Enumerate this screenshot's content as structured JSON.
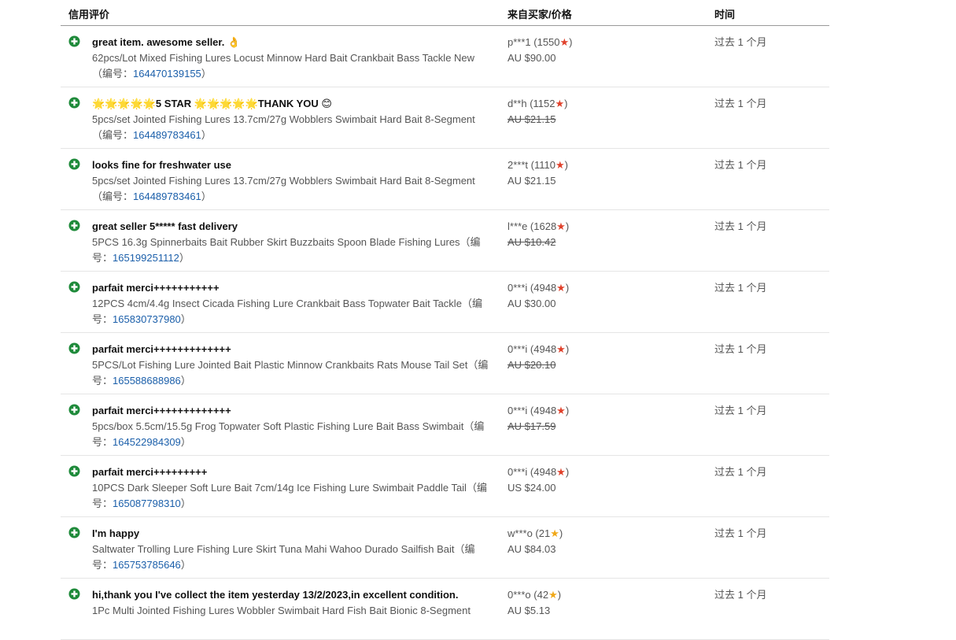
{
  "header": {
    "col_feedback": "信用评价",
    "col_from": "来自买家/价格",
    "col_time": "时间"
  },
  "colors": {
    "positive_green": "#1e8a3a",
    "link_blue": "#1b5faa",
    "star_red": "#e0412b",
    "star_yellow": "#f0a818"
  },
  "item_prefix": "（编号：",
  "item_suffix": "）",
  "rows": [
    {
      "comment": "great item. awesome seller. 👌",
      "desc": "62pcs/Lot Mixed Fishing Lures Locust Minnow Hard Bait Crankbait Bass Tackle New",
      "item": "164470139155",
      "buyer": "p***1",
      "score": "1550",
      "star": "red",
      "price": "AU $90.00",
      "strike": false,
      "time": "过去 1 个月"
    },
    {
      "comment": "🌟🌟🌟🌟🌟5 STAR 🌟🌟🌟🌟🌟THANK YOU 😊",
      "desc": "5pcs/set Jointed Fishing Lures 13.7cm/27g Wobblers Swimbait Hard Bait 8-Segment",
      "item": "164489783461",
      "buyer": "d**h",
      "score": "1152",
      "star": "red",
      "price": "AU $21.15",
      "strike": true,
      "time": "过去 1 个月"
    },
    {
      "comment": "looks fine for freshwater use",
      "desc": "5pcs/set Jointed Fishing Lures 13.7cm/27g Wobblers Swimbait Hard Bait 8-Segment",
      "item": "164489783461",
      "buyer": "2***t",
      "score": "1110",
      "star": "red",
      "price": "AU $21.15",
      "strike": false,
      "time": "过去 1 个月"
    },
    {
      "comment": "great seller 5***** fast delivery",
      "desc": "5PCS 16.3g Spinnerbaits Bait Rubber Skirt Buzzbaits Spoon Blade Fishing Lures",
      "item": "165199251112",
      "buyer": "l***e",
      "score": "1628",
      "star": "red",
      "price": "AU $10.42",
      "strike": true,
      "time": "过去 1 个月"
    },
    {
      "comment": "parfait merci+++++++++++",
      "desc": "12PCS 4cm/4.4g Insect Cicada Fishing Lure Crankbait Bass Topwater Bait Tackle",
      "item": "165830737980",
      "buyer": "0***i",
      "score": "4948",
      "star": "red",
      "price": "AU $30.00",
      "strike": false,
      "time": "过去 1 个月"
    },
    {
      "comment": "parfait merci+++++++++++++",
      "desc": "5PCS/Lot Fishing Lure Jointed Bait Plastic Minnow Crankbaits Rats Mouse Tail Set",
      "item": "165588688986",
      "buyer": "0***i",
      "score": "4948",
      "star": "red",
      "price": "AU $20.10",
      "strike": true,
      "time": "过去 1 个月"
    },
    {
      "comment": "parfait merci+++++++++++++",
      "desc": "5pcs/box 5.5cm/15.5g Frog Topwater Soft Plastic Fishing Lure Bait Bass Swimbait",
      "item": "164522984309",
      "buyer": "0***i",
      "score": "4948",
      "star": "red",
      "price": "AU $17.59",
      "strike": true,
      "time": "过去 1 个月"
    },
    {
      "comment": "parfait merci+++++++++",
      "desc": "10PCS Dark Sleeper Soft Lure Bait 7cm/14g Ice Fishing Lure Swimbait Paddle Tail",
      "item": "165087798310",
      "buyer": "0***i",
      "score": "4948",
      "star": "red",
      "price": "US $24.00",
      "strike": false,
      "time": "过去 1 个月"
    },
    {
      "comment": "I'm happy",
      "desc": "Saltwater Trolling Lure Fishing Lure Skirt Tuna Mahi Wahoo Durado Sailfish Bait",
      "item": "165753785646",
      "buyer": "w***o",
      "score": "21",
      "star": "yellow",
      "price": "AU $84.03",
      "strike": false,
      "time": "过去 1 个月"
    },
    {
      "comment": "hi,thank you I've collect the item yesterday 13/2/2023,in excellent condition.",
      "desc": "1Pc Multi Jointed Fishing Lures Wobbler Swimbait Hard Fish Bait Bionic 8-Segment",
      "item": "",
      "buyer": "0***o",
      "score": "42",
      "star": "yellow",
      "price": "AU $5.13",
      "strike": false,
      "time": "过去 1 个月"
    }
  ]
}
